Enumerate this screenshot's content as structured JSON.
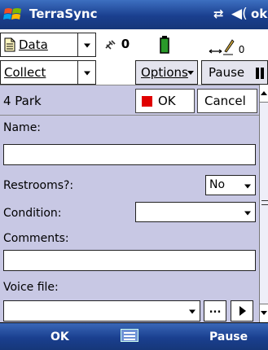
{
  "titlebar": {
    "app_title": "TerraSync",
    "ok_label": "ok"
  },
  "toolbar": {
    "section_label": "Data",
    "satellite_count": "0",
    "ruler_value": "0"
  },
  "menu": {
    "collect_label": "Collect",
    "options_label": "Options",
    "pause_label": "Pause"
  },
  "form": {
    "feature_title": "4 Park",
    "ok_label": "OK",
    "cancel_label": "Cancel",
    "fields": {
      "name_label": "Name:",
      "name_value": "",
      "restrooms_label": "Restrooms?:",
      "restrooms_value": "No",
      "condition_label": "Condition:",
      "condition_value": "",
      "comments_label": "Comments:",
      "comments_value": "",
      "voice_label": "Voice file:",
      "voice_value": "",
      "browse_label": "..."
    }
  },
  "softkeys": {
    "left": "OK",
    "right": "Pause"
  },
  "icons": {
    "windows": "windows-logo-icon",
    "connectivity": "connectivity-icon",
    "volume": "volume-icon",
    "document": "document-icon",
    "satellite": "satellite-icon",
    "battery": "battery-icon",
    "ruler": "measure-icon",
    "keyboard": "keyboard-icon"
  },
  "colors": {
    "titlebar": "#1a3f8f",
    "form_bg": "#c8c8e4",
    "ok_square": "#e00000",
    "battery": "#2a9a2a"
  }
}
